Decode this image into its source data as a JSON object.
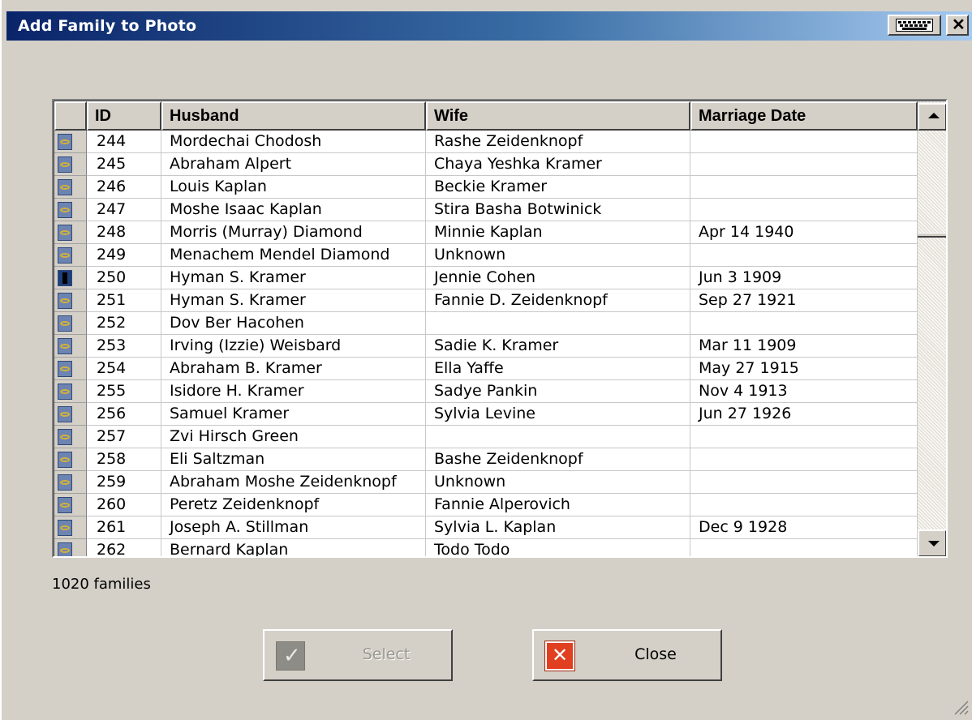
{
  "window": {
    "title": "Add Family to Photo"
  },
  "titlebar": {
    "keyboard_icon": "keyboard-icon",
    "close_icon": "close-icon"
  },
  "grid": {
    "columns": [
      "ID",
      "Husband",
      "Wife",
      "Marriage Date"
    ],
    "rows": [
      {
        "state": "normal",
        "id": "244",
        "husband": "Mordechai Chodosh",
        "wife": "Rashe Zeidenknopf",
        "date": ""
      },
      {
        "state": "normal",
        "id": "245",
        "husband": "Abraham Alpert",
        "wife": "Chaya Yeshka Kramer",
        "date": ""
      },
      {
        "state": "normal",
        "id": "246",
        "husband": "Louis Kaplan",
        "wife": "Beckie Kramer",
        "date": ""
      },
      {
        "state": "normal",
        "id": "247",
        "husband": "Moshe Isaac Kaplan",
        "wife": "Stira Basha Botwinick",
        "date": ""
      },
      {
        "state": "normal",
        "id": "248",
        "husband": "Morris (Murray) Diamond",
        "wife": "Minnie Kaplan",
        "date": "Apr 14 1940"
      },
      {
        "state": "normal",
        "id": "249",
        "husband": "Menachem Mendel Diamond",
        "wife": "Unknown",
        "date": ""
      },
      {
        "state": "selected",
        "id": "250",
        "husband": "Hyman S. Kramer",
        "wife": "Jennie Cohen",
        "date": "Jun 3 1909"
      },
      {
        "state": "normal",
        "id": "251",
        "husband": "Hyman S. Kramer",
        "wife": "Fannie D. Zeidenknopf",
        "date": "Sep 27 1921"
      },
      {
        "state": "normal",
        "id": "252",
        "husband": "Dov Ber Hacohen",
        "wife": "",
        "date": ""
      },
      {
        "state": "normal",
        "id": "253",
        "husband": "Irving (Izzie) Weisbard",
        "wife": "Sadie K. Kramer",
        "date": "Mar 11 1909"
      },
      {
        "state": "normal",
        "id": "254",
        "husband": "Abraham B. Kramer",
        "wife": "Ella Yaffe",
        "date": "May 27 1915"
      },
      {
        "state": "normal",
        "id": "255",
        "husband": "Isidore H. Kramer",
        "wife": "Sadye Pankin",
        "date": "Nov 4 1913"
      },
      {
        "state": "normal",
        "id": "256",
        "husband": "Samuel Kramer",
        "wife": "Sylvia Levine",
        "date": "Jun 27 1926"
      },
      {
        "state": "normal",
        "id": "257",
        "husband": "Zvi Hirsch Green",
        "wife": "",
        "date": ""
      },
      {
        "state": "normal",
        "id": "258",
        "husband": "Eli Saltzman",
        "wife": "Bashe Zeidenknopf",
        "date": ""
      },
      {
        "state": "normal",
        "id": "259",
        "husband": "Abraham Moshe Zeidenknopf",
        "wife": "Unknown",
        "date": ""
      },
      {
        "state": "normal",
        "id": "260",
        "husband": "Peretz Zeidenknopf",
        "wife": "Fannie Alperovich",
        "date": ""
      },
      {
        "state": "normal",
        "id": "261",
        "husband": "Joseph A. Stillman",
        "wife": "Sylvia L. Kaplan",
        "date": "Dec 9 1928"
      },
      {
        "state": "normal",
        "id": "262",
        "husband": "Bernard Kaplan",
        "wife": "Todo Todo",
        "date": ""
      }
    ]
  },
  "status": {
    "count_text": "1020 families"
  },
  "buttons": {
    "select_label": "Select",
    "select_enabled": false,
    "close_label": "Close"
  },
  "colors": {
    "titlebar_start": "#0a246a",
    "titlebar_end": "#a6caf0",
    "face": "#d4d0c8",
    "close_icon_red": "#e04020"
  }
}
